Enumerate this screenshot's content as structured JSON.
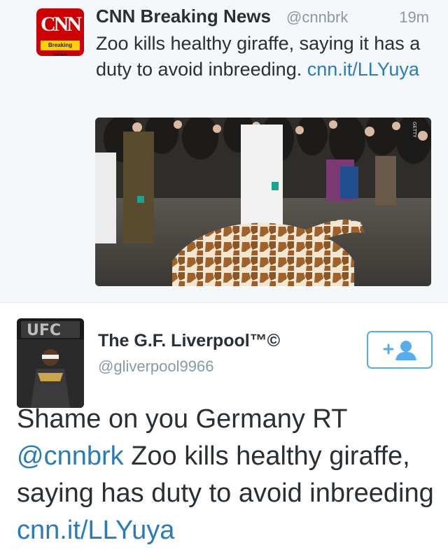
{
  "quoted_tweet": {
    "logo_text": "CNN",
    "logo_strip": "Breaking news",
    "name": "CNN Breaking News",
    "handle": "@cnnbrk",
    "time": "19m",
    "text": "Zoo kills healthy giraffe, saying it has a duty to avoid inbreeding.",
    "link": "cnn.it/LLYuya",
    "photo_credit": "GETTY"
  },
  "tweet": {
    "avatar_label": "UFC",
    "name": "The G.F. Liverpool™©",
    "handle": "@gliverpool9966",
    "text_prefix": "Shame on you Germany RT",
    "mention": "@cnnbrk",
    "text_body": "Zoo kills healthy giraffe, saying has duty to avoid inbreeding",
    "link": "cnn.it/LLYuya"
  },
  "colors": {
    "link": "#2b7bb9",
    "follow_border": "#55acee",
    "cnn_red": "#cc0000"
  }
}
